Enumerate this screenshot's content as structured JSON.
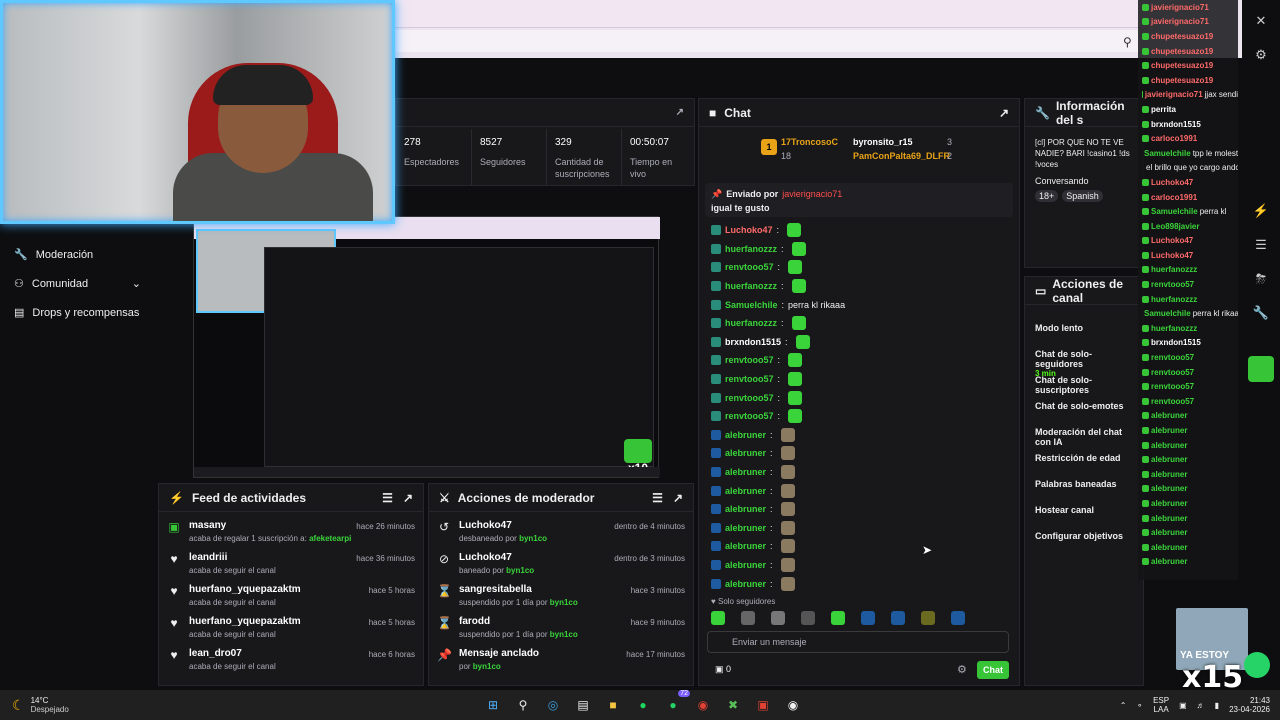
{
  "browser": {
    "zoom_icon": "zoom-icon"
  },
  "stats": [
    {
      "value": "278",
      "label": "Espectadores"
    },
    {
      "value": "8527",
      "label": "Seguidores"
    },
    {
      "value": "329",
      "label": "Cantidad de suscripciones"
    },
    {
      "value": "00:50:07",
      "label": "Tiempo en vivo"
    }
  ],
  "nav": [
    {
      "label": "Moderación",
      "icon": "wrench-icon"
    },
    {
      "label": "Comunidad",
      "icon": "people-icon"
    },
    {
      "label": "Drops y recompensas",
      "icon": "gift-icon"
    }
  ],
  "preview": {
    "x_label": "x10"
  },
  "feed": {
    "title": "Feed de actividades",
    "items": [
      {
        "name": "masany",
        "sub": "acaba de regalar 1 suscripción a:",
        "sub_extra": "afeketearpi",
        "time": "hace 26 minutos"
      },
      {
        "name": "leandriii",
        "sub": "acaba de seguir el canal",
        "sub_extra": "",
        "time": "hace 36 minutos"
      },
      {
        "name": "huerfano_yquepazaktm",
        "sub": "acaba de seguir el canal",
        "sub_extra": "",
        "time": "hace 5 horas"
      },
      {
        "name": "huerfano_yquepazaktm",
        "sub": "acaba de seguir el canal",
        "sub_extra": "",
        "time": "hace 5 horas"
      },
      {
        "name": "lean_dro07",
        "sub": "acaba de seguir el canal",
        "sub_extra": "",
        "time": "hace 6 horas"
      }
    ]
  },
  "modact": {
    "title": "Acciones de moderador",
    "items": [
      {
        "name": "Luchoko47",
        "sub": "desbaneado por",
        "sub_extra": "byn1co",
        "time": "dentro de 4 minutos"
      },
      {
        "name": "Luchoko47",
        "sub": "baneado por",
        "sub_extra": "byn1co",
        "time": "dentro de 3 minutos"
      },
      {
        "name": "sangresitabella",
        "sub": "suspendido por 1 día por",
        "sub_extra": "byn1co",
        "time": "hace 3 minutos"
      },
      {
        "name": "farodd",
        "sub": "suspendido por 1 día por",
        "sub_extra": "byn1co",
        "time": "hace 9 minutos"
      },
      {
        "name": "Mensaje anclado",
        "sub": "por",
        "sub_extra": "byn1co",
        "time": "hace 17 minutos"
      }
    ]
  },
  "chat": {
    "title": "Chat",
    "leaderboard": [
      {
        "name": "17TroncosoC",
        "count": "18"
      },
      {
        "name": "byronsito_r15",
        "count": "3"
      },
      {
        "name": "PamConPalta69_DLFR",
        "count": "2"
      }
    ],
    "rank": "1",
    "pinned": {
      "by_label": "Enviado por",
      "by_user": "javierignacio71",
      "text": "igual te gusto"
    },
    "messages": [
      {
        "user": "Luchoko47",
        "text": "",
        "color": "#ff6a6a"
      },
      {
        "user": "huerfanozzz",
        "text": "",
        "color": "#3ad43a"
      },
      {
        "user": "renvtooo57",
        "text": "",
        "color": "#3ad43a"
      },
      {
        "user": "huerfanozzz",
        "text": "",
        "color": "#3ad43a"
      },
      {
        "user": "Samuelchile",
        "text": "perra kl rikaaa",
        "color": "#3ad43a"
      },
      {
        "user": "huerfanozzz",
        "text": "",
        "color": "#3ad43a"
      },
      {
        "user": "brxndon1515",
        "text": "",
        "color": "#ffffff"
      },
      {
        "user": "renvtooo57",
        "text": "",
        "color": "#3ad43a"
      },
      {
        "user": "renvtooo57",
        "text": "",
        "color": "#3ad43a"
      },
      {
        "user": "renvtooo57",
        "text": "",
        "color": "#3ad43a"
      },
      {
        "user": "renvtooo57",
        "text": "",
        "color": "#3ad43a"
      },
      {
        "user": "alebruner",
        "text": "",
        "color": "#3ad43a"
      },
      {
        "user": "alebruner",
        "text": "",
        "color": "#3ad43a"
      },
      {
        "user": "alebruner",
        "text": "",
        "color": "#3ad43a"
      },
      {
        "user": "alebruner",
        "text": "",
        "color": "#3ad43a"
      },
      {
        "user": "alebruner",
        "text": "",
        "color": "#3ad43a"
      },
      {
        "user": "alebruner",
        "text": "",
        "color": "#3ad43a"
      },
      {
        "user": "alebruner",
        "text": "",
        "color": "#3ad43a"
      },
      {
        "user": "alebruner",
        "text": "",
        "color": "#3ad43a"
      },
      {
        "user": "alebruner",
        "text": "",
        "color": "#3ad43a"
      }
    ],
    "followers_only": "Solo seguidores",
    "input_placeholder": "Enviar un mensaje",
    "points": "0",
    "send_label": "Chat"
  },
  "info": {
    "title": "Información del s",
    "stream_title": "[cl] POR QUE NO TE VE NADIE? BARI !casino1 !ds !voces",
    "category": "Conversando",
    "tags": [
      "18+",
      "Spanish"
    ]
  },
  "actions": {
    "title": "Acciones de canal",
    "items": [
      {
        "label": "Modo lento",
        "sub": ""
      },
      {
        "label": "Chat de solo-seguidores",
        "sub": "3 min"
      },
      {
        "label": "Chat de solo-suscriptores",
        "sub": ""
      },
      {
        "label": "Chat de solo-emotes",
        "sub": ""
      },
      {
        "label": "Moderación del chat con IA",
        "sub": ""
      },
      {
        "label": "Restricción de edad",
        "sub": ""
      },
      {
        "label": "Palabras baneadas",
        "sub": ""
      },
      {
        "label": "Hostear canal",
        "sub": ""
      },
      {
        "label": "Configurar objetivos",
        "sub": ""
      }
    ]
  },
  "side_chat": [
    {
      "user": "javierignacio71",
      "text": "",
      "color": "#ff6a6a"
    },
    {
      "user": "javierignacio71",
      "text": "",
      "color": "#ff6a6a"
    },
    {
      "user": "chupetesuazo19",
      "text": "",
      "color": "#ff6a6a"
    },
    {
      "user": "chupetesuazo19",
      "text": "",
      "color": "#ff6a6a"
    },
    {
      "user": "chupetesuazo19",
      "text": "",
      "color": "#ff6a6a"
    },
    {
      "user": "chupetesuazo19",
      "text": "",
      "color": "#ff6a6a"
    },
    {
      "user": "javierignacio71",
      "text": "jjax sendi",
      "color": "#ff6a6a"
    },
    {
      "user": "perrita",
      "text": "",
      "color": "#ffffff"
    },
    {
      "user": "brxndon1515",
      "text": "",
      "color": "#ffffff"
    },
    {
      "user": "carloco1991",
      "text": "",
      "color": "#ff6a6a"
    },
    {
      "user": "Samuelchile",
      "text": "tpp le molesta",
      "color": "#3ad43a"
    },
    {
      "user": "",
      "text": "el brillo que yo cargo ando en el mustang bien aselerasooo",
      "color": "#ffffff"
    },
    {
      "user": "Luchoko47",
      "text": "",
      "color": "#ff6a6a"
    },
    {
      "user": "carloco1991",
      "text": "",
      "color": "#ff6a6a"
    },
    {
      "user": "Samuelchile",
      "text": "perra kl",
      "color": "#3ad43a"
    },
    {
      "user": "Leo898javier",
      "text": "",
      "color": "#3ad43a"
    },
    {
      "user": "Luchoko47",
      "text": "",
      "color": "#ff6a6a"
    },
    {
      "user": "Luchoko47",
      "text": "",
      "color": "#ff6a6a"
    },
    {
      "user": "huerfanozzz",
      "text": "",
      "color": "#3ad43a"
    },
    {
      "user": "renvtooo57",
      "text": "",
      "color": "#3ad43a"
    },
    {
      "user": "huerfanozzz",
      "text": "",
      "color": "#3ad43a"
    },
    {
      "user": "Samuelchile",
      "text": "perra kl rikaaa",
      "color": "#3ad43a"
    },
    {
      "user": "huerfanozzz",
      "text": "",
      "color": "#3ad43a"
    },
    {
      "user": "brxndon1515",
      "text": "",
      "color": "#ffffff"
    },
    {
      "user": "renvtooo57",
      "text": "",
      "color": "#3ad43a"
    },
    {
      "user": "renvtooo57",
      "text": "",
      "color": "#3ad43a"
    },
    {
      "user": "renvtooo57",
      "text": "",
      "color": "#3ad43a"
    },
    {
      "user": "renvtooo57",
      "text": "",
      "color": "#3ad43a"
    },
    {
      "user": "alebruner",
      "text": "",
      "color": "#3ad43a"
    },
    {
      "user": "alebruner",
      "text": "",
      "color": "#3ad43a"
    },
    {
      "user": "alebruner",
      "text": "",
      "color": "#3ad43a"
    },
    {
      "user": "alebruner",
      "text": "",
      "color": "#3ad43a"
    },
    {
      "user": "alebruner",
      "text": "",
      "color": "#3ad43a"
    },
    {
      "user": "alebruner",
      "text": "",
      "color": "#3ad43a"
    },
    {
      "user": "alebruner",
      "text": "",
      "color": "#3ad43a"
    },
    {
      "user": "alebruner",
      "text": "",
      "color": "#3ad43a"
    },
    {
      "user": "alebruner",
      "text": "",
      "color": "#3ad43a"
    },
    {
      "user": "alebruner",
      "text": "",
      "color": "#3ad43a"
    },
    {
      "user": "alebruner",
      "text": "",
      "color": "#3ad43a"
    }
  ],
  "overlay": {
    "corner_text": "YA ESTOY",
    "x_label": "x15"
  },
  "taskbar": {
    "weather_temp": "14°C",
    "weather_desc": "Despejado",
    "lang": "ESP",
    "lang_sub": "LAA",
    "time": "21:43",
    "date": "23-04-2026",
    "badge_count": "72"
  },
  "colors": {
    "accent": "#53fc18",
    "bg": "#0e0e10",
    "panel": "#18181b"
  }
}
